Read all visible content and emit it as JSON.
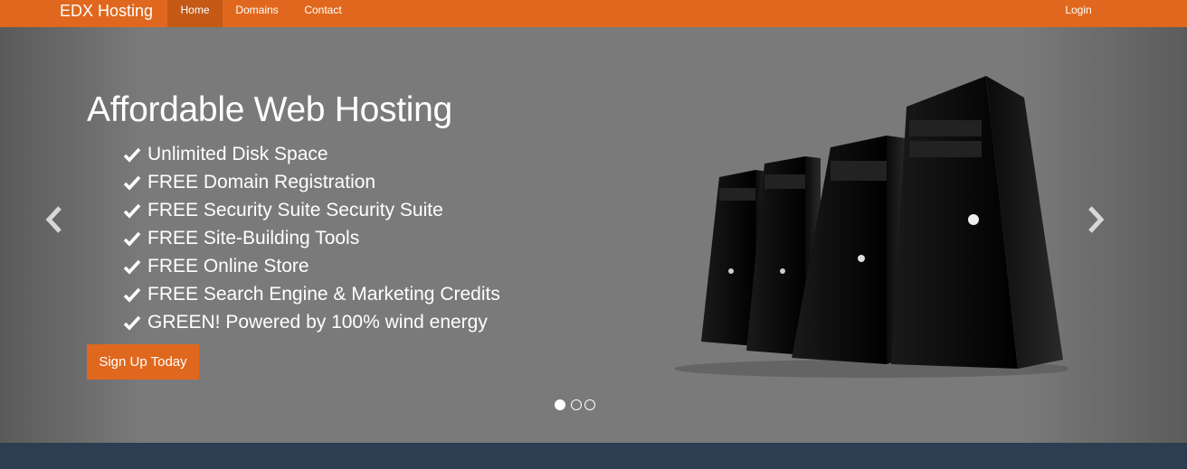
{
  "navbar": {
    "brand": "EDX Hosting",
    "items": [
      {
        "label": "Home",
        "active": true
      },
      {
        "label": "Domains",
        "active": false
      },
      {
        "label": "Contact",
        "active": false
      }
    ],
    "login_label": "Login"
  },
  "hero": {
    "title": "Affordable Web Hosting",
    "features": [
      "Unlimited Disk Space",
      "FREE Domain Registration",
      "FREE Security Suite Security Suite",
      "FREE Site-Building Tools",
      "FREE Online Store",
      "FREE Search Engine & Marketing Credits",
      "GREEN! Powered by 100% wind energy"
    ],
    "cta_label": "Sign Up Today",
    "carousel": {
      "slide_count": 3,
      "active_index": 0
    }
  },
  "icons": {
    "check": "check-icon",
    "prev": "chevron-left-icon",
    "next": "chevron-right-icon",
    "image": "server-towers-image"
  },
  "colors": {
    "brand_orange": "#e0681e",
    "active_nav": "#c55a17",
    "hero_gray": "#7a7a7a",
    "footer_navy": "#2c3e50",
    "text": "#ffffff"
  }
}
